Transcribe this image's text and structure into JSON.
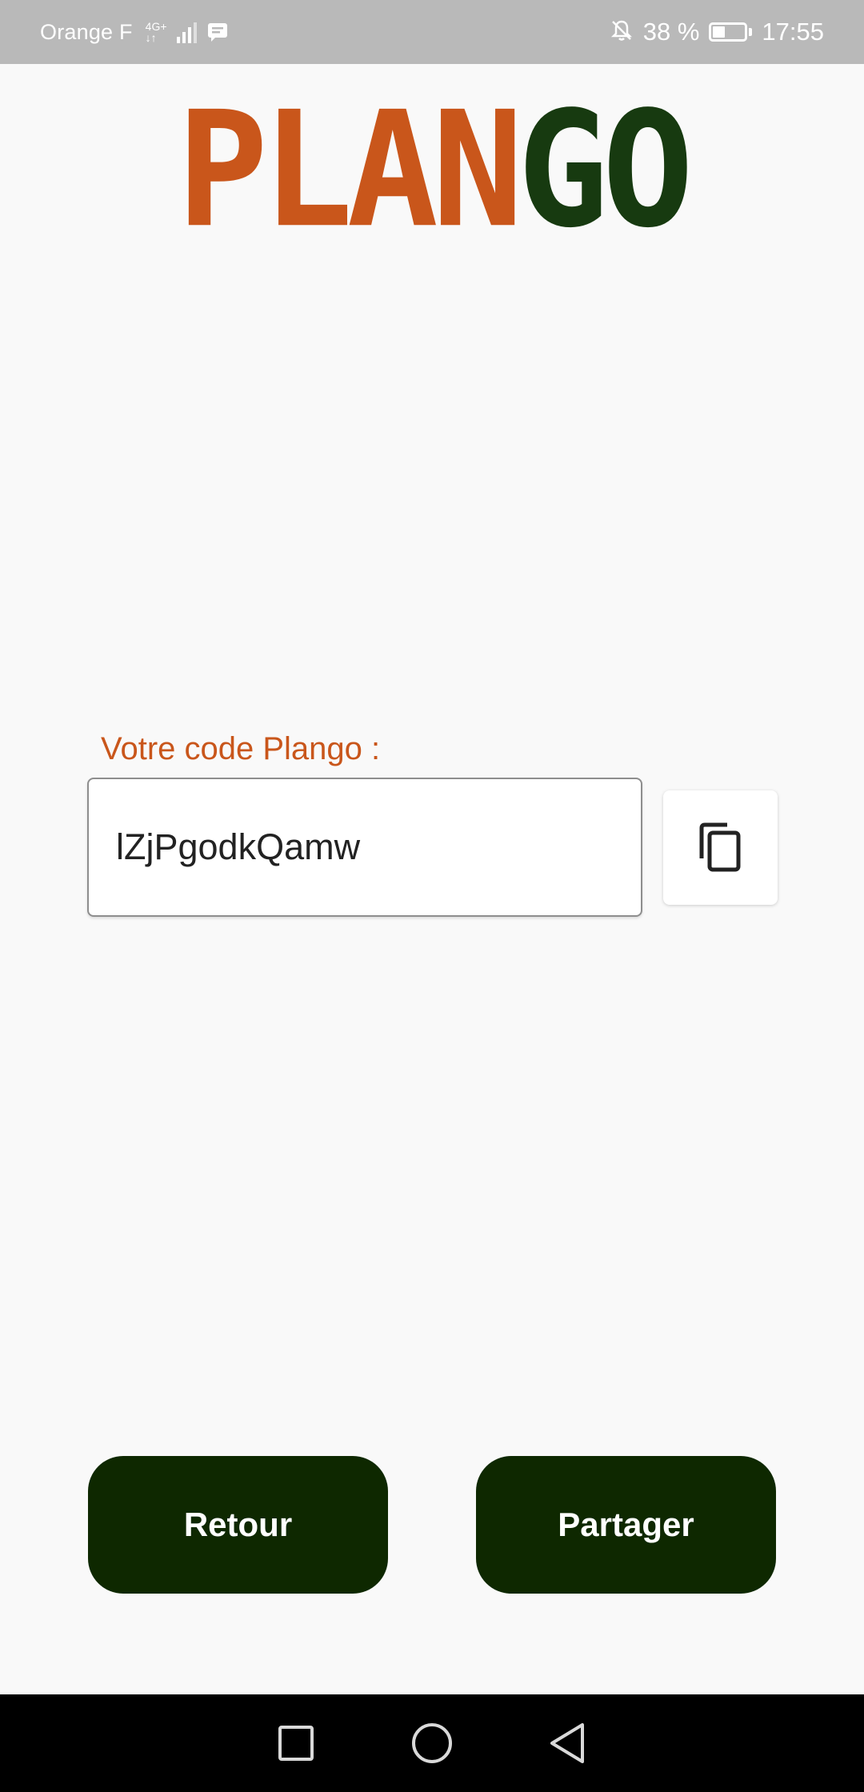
{
  "status_bar": {
    "carrier": "Orange F",
    "network_type": "4G+",
    "network_sub": "↓↑",
    "battery_percent": "38 %",
    "battery_level": 0.38,
    "time": "17:55"
  },
  "logo": {
    "part_a": "PLAN",
    "part_b": "GO",
    "colors": {
      "part_a": "#c9561b",
      "part_b": "#173a10"
    }
  },
  "code_section": {
    "label": "Votre code Plango :",
    "value": "lZjPgodkQamw"
  },
  "copy_button": {
    "icon": "copy-icon"
  },
  "actions": {
    "back_label": "Retour",
    "share_label": "Partager"
  },
  "nav_bar": {
    "icons": [
      "square-recents-icon",
      "circle-home-icon",
      "triangle-back-icon"
    ]
  },
  "colors": {
    "accent_orange": "#c9561b",
    "dark_green": "#0e2800",
    "background": "#f9f9f9"
  }
}
